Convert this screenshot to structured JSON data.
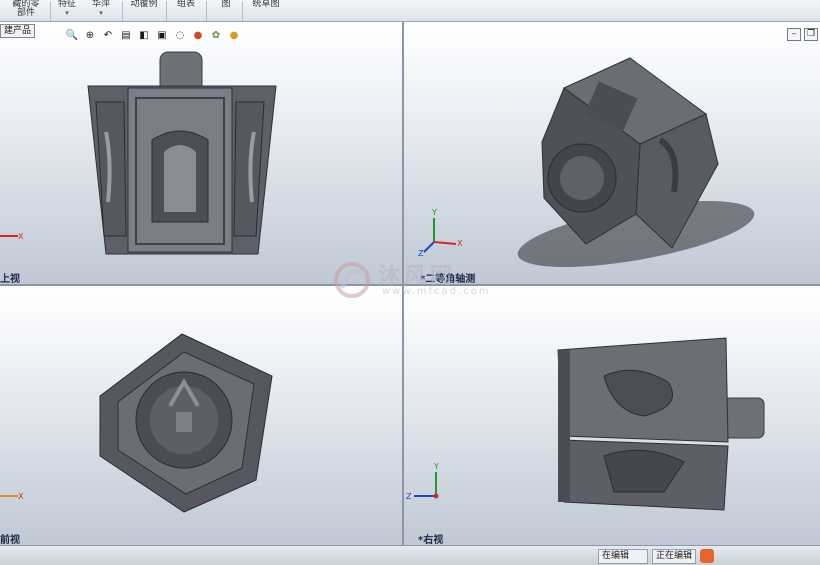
{
  "ribbon": {
    "items": [
      {
        "label": "藏的零\n部件",
        "dropdown": false
      },
      {
        "label": "特征",
        "dropdown": true
      },
      {
        "label": "华萍",
        "dropdown": true
      },
      {
        "label": "动覆例",
        "dropdown": false
      },
      {
        "label": "组表",
        "dropdown": false
      },
      {
        "label": "图",
        "dropdown": false
      },
      {
        "label": "统草图",
        "dropdown": false
      }
    ]
  },
  "viewport_tab_label": "建产品",
  "views": {
    "top_left": {
      "label": "上视",
      "axis_x": "X"
    },
    "top_right": {
      "label": "*二等角轴测",
      "axis_x": "X",
      "axis_y": "Y",
      "axis_z": "Z"
    },
    "bottom_left": {
      "label": "前视",
      "axis_x": "X"
    },
    "bottom_right": {
      "label": "*右视",
      "axis_y": "Y",
      "axis_z": "Z"
    }
  },
  "heads_up_toolbar": {
    "icons": [
      "zoom-to-fit-icon",
      "zoom-area-icon",
      "previous-view-icon",
      "section-view-icon",
      "view-orientation-icon",
      "display-style-icon",
      "hide-show-icon",
      "edit-appearance-icon",
      "apply-scene-icon",
      "view-settings-icon"
    ]
  },
  "watermark": {
    "text": "沐风网",
    "url": "www.mfcad.com"
  },
  "statusbar": {
    "items": [
      "在编辑",
      "正在编辑"
    ]
  },
  "colors": {
    "model": "#6b6e75",
    "model_dark": "#3f4147",
    "background_top": "#ffffff",
    "background_bottom": "#bfc8d4",
    "axis_x": "#d22b2b",
    "axis_y": "#1f9a2a",
    "axis_z": "#2344c9"
  }
}
